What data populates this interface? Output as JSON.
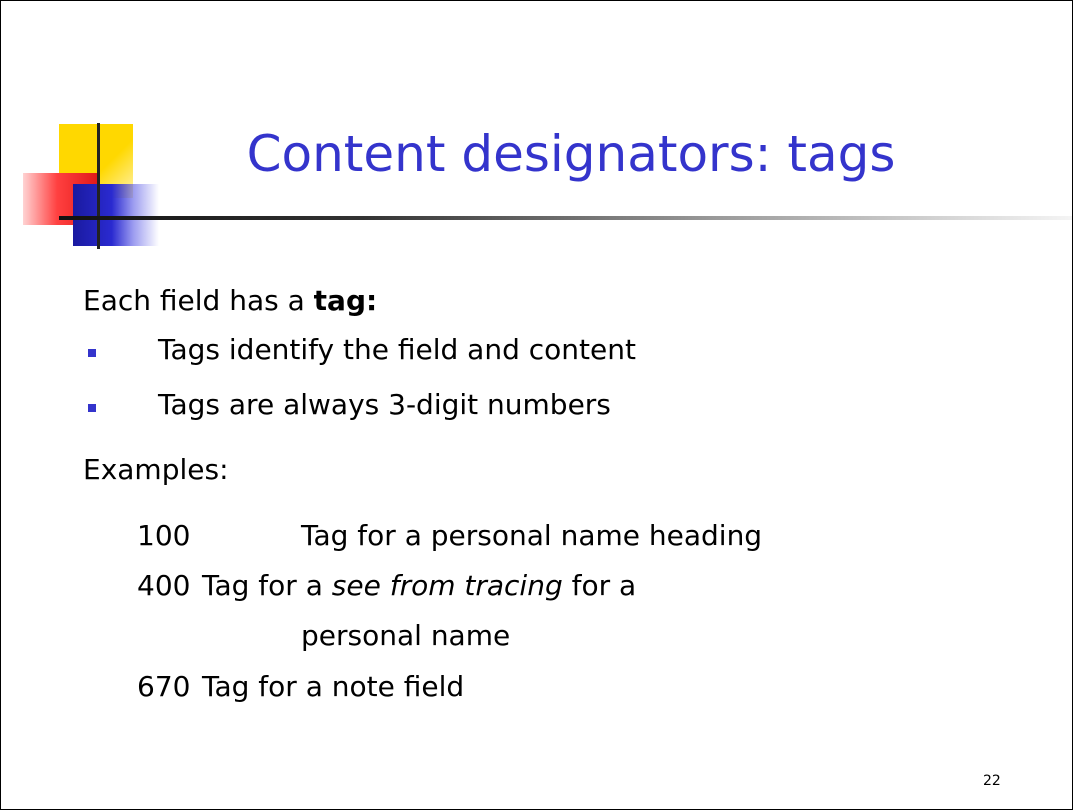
{
  "slide": {
    "title": "Content designators: tags",
    "lead_prefix": "Each field has a ",
    "lead_bold": "tag:",
    "bullets": [
      "Tags identify the field and content",
      "Tags are always 3-digit numbers"
    ],
    "examples_label": "Examples:",
    "examples": [
      {
        "tag": "100",
        "desc": "Tag for a personal name heading"
      },
      {
        "tag": "400",
        "desc_a": "Tag for a ",
        "desc_italic": "see from tracing",
        "desc_b": " for a",
        "desc_cont": "personal name"
      },
      {
        "tag": "670",
        "desc": "Tag for a note field"
      }
    ],
    "page_number": "22"
  },
  "colors": {
    "title": "#3434cc",
    "bullet": "#3434cc",
    "logo_yellow": "#ffd800",
    "logo_red": "#ff4040",
    "logo_blue": "#2a2ad0"
  }
}
